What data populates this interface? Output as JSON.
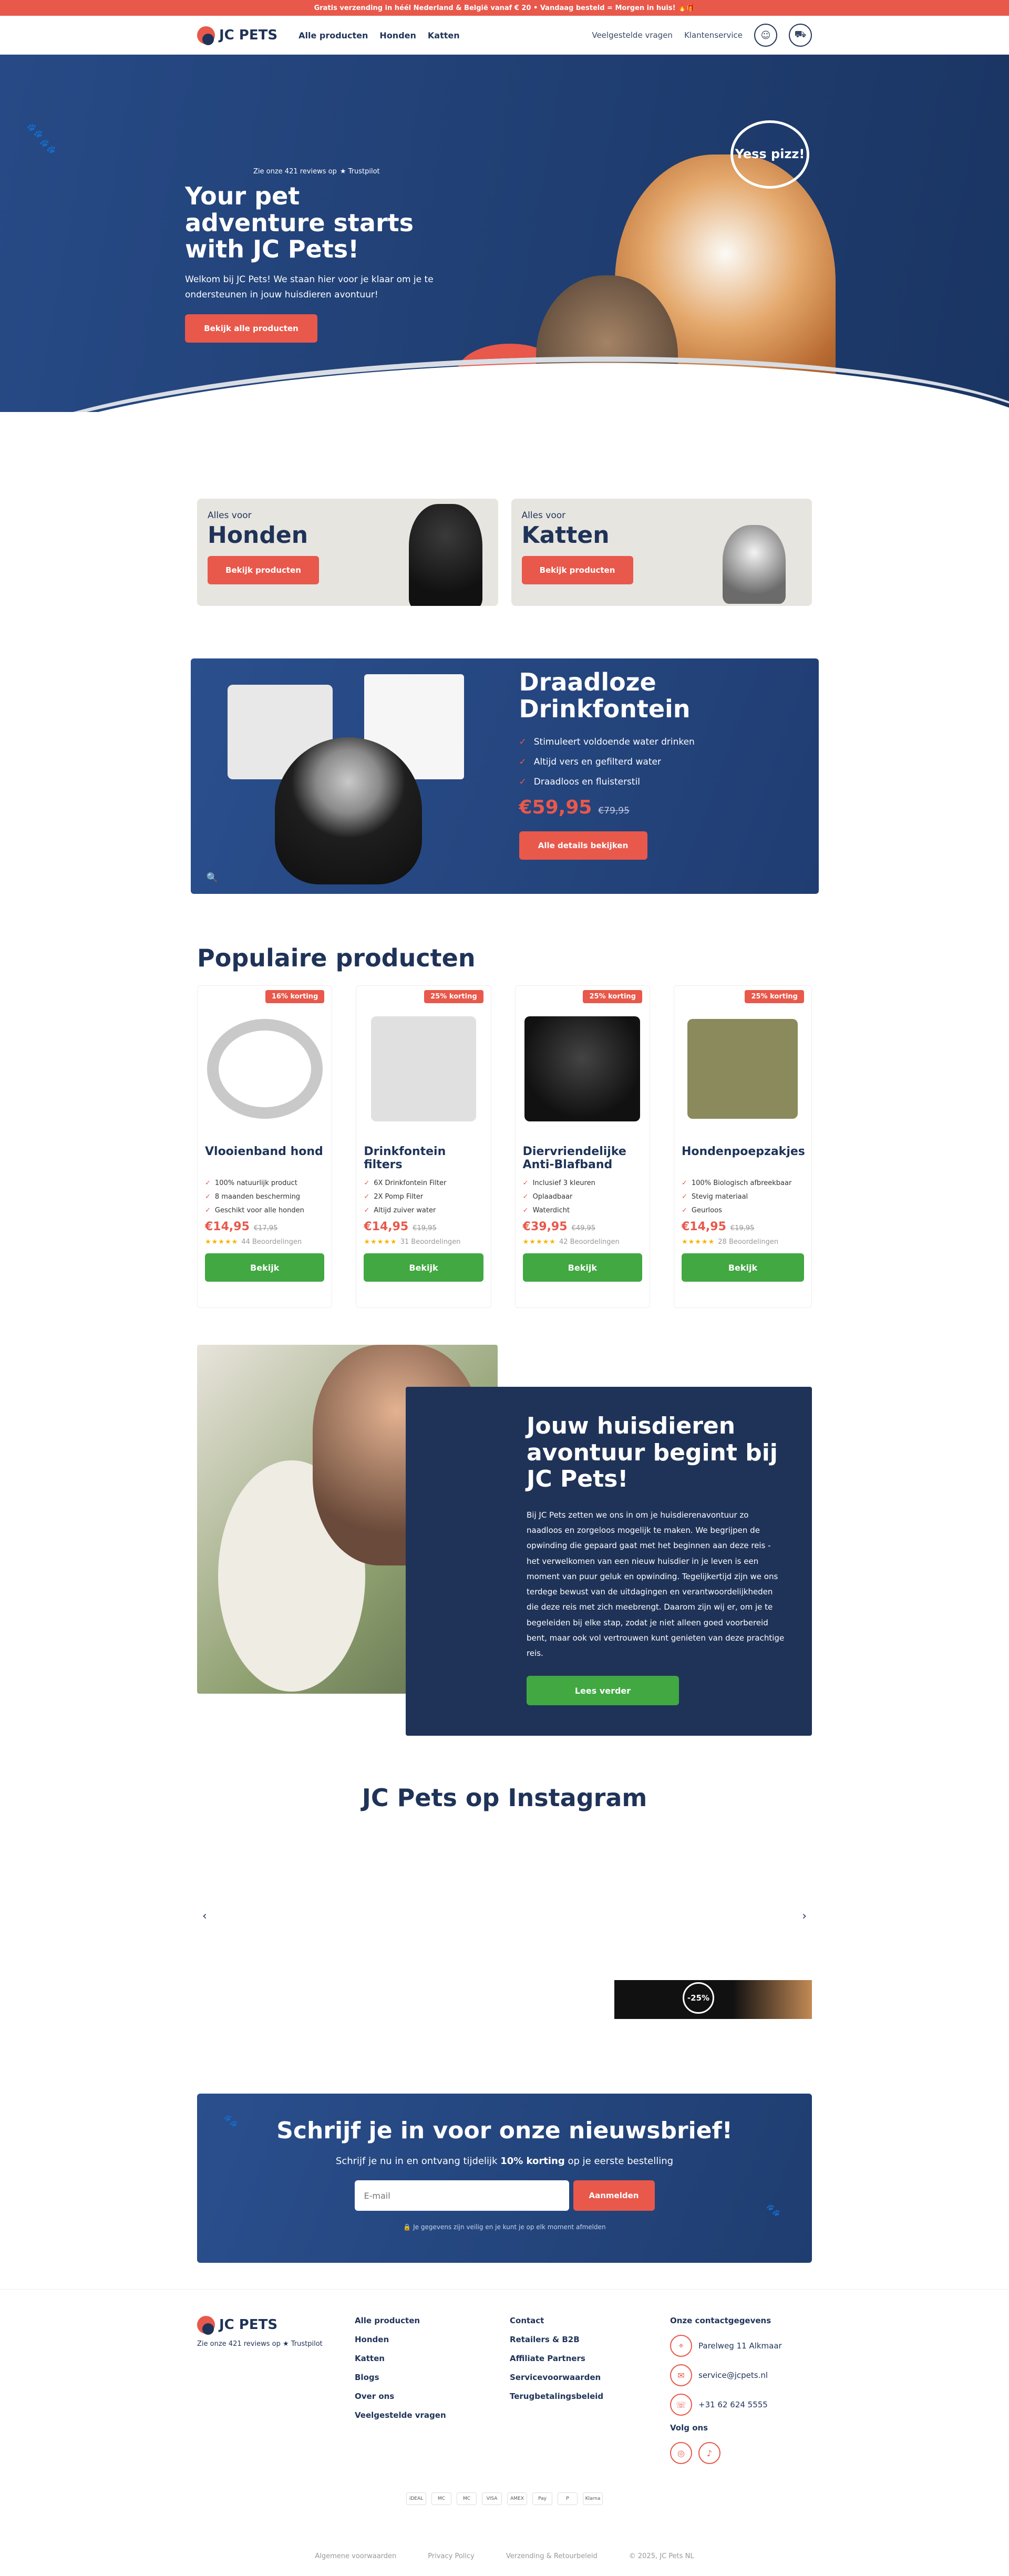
{
  "topbar": {
    "text": "Gratis verzending in héél Nederland & België vanaf € 20 • Vandaag besteld = Morgen in huis! 🔥🎁"
  },
  "header": {
    "logo": "JC PETS",
    "nav": [
      "Alle producten",
      "Honden",
      "Katten"
    ],
    "nav_right": [
      "Veelgestelde vragen",
      "Klantenservice"
    ]
  },
  "hero": {
    "reviews": "Zie onze 421 reviews op",
    "trustpilot": "★ Trustpilot",
    "title": "Your pet adventure starts with JC Pets!",
    "subtitle": "Welkom bij JC Pets! We staan hier voor je klaar om je te ondersteunen in jouw huisdieren avontuur!",
    "button": "Bekijk alle producten",
    "bubble": "Yess pizz!"
  },
  "categories": [
    {
      "small": "Alles voor",
      "big": "Honden",
      "button": "Bekijk producten"
    },
    {
      "small": "Alles voor",
      "big": "Katten",
      "button": "Bekijk producten"
    }
  ],
  "feature": {
    "title": "Draadloze Drinkfontein",
    "bullets": [
      "Stimuleert voldoende water drinken",
      "Altijd vers en gefilterd water",
      "Draadloos en fluisterstil"
    ],
    "price": "€59,95",
    "old_price": "€79,95",
    "button": "Alle details bekijken"
  },
  "popular": {
    "title": "Populaire producten",
    "products": [
      {
        "badge": "16% korting",
        "name": "Vlooienband hond",
        "features": [
          "100% natuurlijk product",
          "8 maanden bescherming",
          "Geschikt voor alle honden"
        ],
        "price": "€14,95",
        "old_price": "€17,95",
        "stars": "★★★★★",
        "reviews": "44 Beoordelingen",
        "button": "Bekijk"
      },
      {
        "badge": "25% korting",
        "name": "Drinkfontein filters",
        "features": [
          "6X Drinkfontein Filter",
          "2X Pomp Filter",
          "Altijd zuiver water"
        ],
        "price": "€14,95",
        "old_price": "€19,95",
        "stars": "★★★★★",
        "reviews": "31 Beoordelingen",
        "button": "Bekijk"
      },
      {
        "badge": "25% korting",
        "name": "Diervriendelijke Anti-Blafband",
        "features": [
          "Inclusief 3 kleuren",
          "Oplaadbaar",
          "Waterdicht"
        ],
        "price": "€39,95",
        "old_price": "€49,95",
        "stars": "★★★★★",
        "reviews": "42 Beoordelingen",
        "button": "Bekijk"
      },
      {
        "badge": "25% korting",
        "name": "Hondenpoepzakjes",
        "features": [
          "100% Biologisch afbreekbaar",
          "Stevig materiaal",
          "Geurloos"
        ],
        "price": "€14,95",
        "old_price": "€19,95",
        "stars": "★★★★★",
        "reviews": "28 Beoordelingen",
        "button": "Bekijk"
      }
    ]
  },
  "about": {
    "title": "Jouw huisdieren avontuur begint bij JC Pets!",
    "text": "Bij JC Pets zetten we ons in om je huisdierenavontuur zo naadloos en zorgeloos mogelijk te maken. We begrijpen de opwinding die gepaard gaat met het beginnen aan deze reis - het verwelkomen van een nieuw huisdier in je leven is een moment van puur geluk en opwinding. Tegelijkertijd zijn we ons terdege bewust van de uitdagingen en verantwoordelijkheden die deze reis met zich meebrengt. Daarom zijn wij er, om je te begeleiden bij elke stap, zodat je niet alleen goed voorbereid bent, maar ook vol vertrouwen kunt genieten van deze prachtige reis.",
    "button": "Lees verder"
  },
  "instagram": {
    "title": "JC Pets op Instagram",
    "prev": "‹",
    "next": "›",
    "thumb_tag": "-25%"
  },
  "newsletter": {
    "title": "Schrijf je in voor onze nieuwsbrief!",
    "subtitle_pre": "Schrijf je nu in en ontvang tijdelijk ",
    "subtitle_bold": "10% korting",
    "subtitle_post": " op je eerste bestelling",
    "placeholder": "E-mail",
    "button": "Aanmelden",
    "privacy": "🔒 Je gegevens zijn veilig en je kunt je op elk moment afmelden"
  },
  "footer": {
    "logo": "JC PETS",
    "reviews": "Zie onze 421 reviews op ★ Trustpilot",
    "col1": [
      "Alle producten",
      "Honden",
      "Katten",
      "Blogs",
      "Over ons",
      "Veelgestelde vragen"
    ],
    "col2": [
      "Contact",
      "Retailers & B2B",
      "Affiliate Partners",
      "Servicevoorwaarden",
      "Terugbetalingsbeleid"
    ],
    "contact_title": "Onze contactgegevens",
    "address": "Parelweg 11 Alkmaar",
    "email": "service@jcpets.nl",
    "phone": "+31 62 624 5555",
    "follow": "Volg ons",
    "payments": [
      "iDEAL",
      "MC",
      "MC",
      "VISA",
      "AMEX",
      "Pay",
      "P",
      "Klarna"
    ],
    "bottom": [
      "Algemene voorwaarden",
      "Privacy Policy",
      "Verzending & Retourbeleid",
      "© 2025, JC Pets NL"
    ]
  }
}
